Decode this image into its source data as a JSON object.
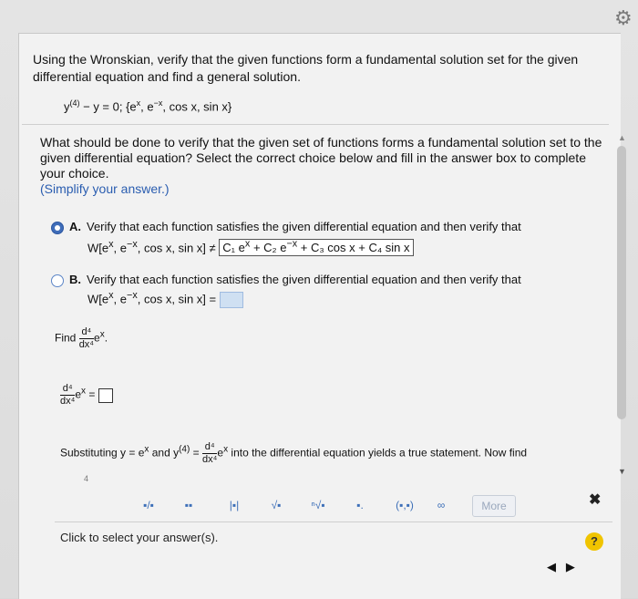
{
  "question_intro": "Using the Wronskian, verify that the given functions form a fundamental solution set for the given differential equation and find a general solution.",
  "equation": {
    "lhs": "y",
    "order_sup": "(4)",
    "rest": " − y = 0;  {e",
    "e_sup1": "x",
    "mid1": ", e",
    "e_sup2": "−x",
    "tail": ", cos x, sin x}"
  },
  "prompt": "What should be done to verify that the given set of functions forms a fundamental solution set to the given differential equation? Select the correct choice below and fill in the answer box to complete your choice.",
  "hint": "(Simplify your answer.)",
  "choices": {
    "A": {
      "label": "A.",
      "text": "Verify that each function satisfies the given differential equation and then verify that",
      "w_prefix": "W[e",
      "w_sup1": "x",
      "w_mid": ", e",
      "w_sup2": "−x",
      "w_tail": ", cos x, sin x]",
      "relation": "≠",
      "answer": "C₁ e",
      "ans_sup1": "x",
      "answer2": " + C₂ e",
      "ans_sup2": "−x",
      "answer3": " + C₃ cos x + C₄ sin x",
      "selected": true
    },
    "B": {
      "label": "B.",
      "text": "Verify that each function satisfies the given differential equation and then verify that",
      "w_prefix": "W[e",
      "w_sup1": "x",
      "w_mid": ", e",
      "w_sup2": "−x",
      "w_tail": ", cos x, sin x]",
      "relation": "=",
      "selected": false
    }
  },
  "find": {
    "label": "Find",
    "num": "d⁴",
    "den": "dx⁴",
    "expr": "e",
    "expr_sup": "x",
    "period": "."
  },
  "derivative_eq": {
    "num": "d⁴",
    "den": "dx⁴",
    "expr": "e",
    "expr_sup": "x",
    "equals": "="
  },
  "substitution": {
    "text1": "Substituting y = e",
    "sup1": "x",
    "text2": " and y",
    "sup2": "(4)",
    "text3": " = ",
    "num": "d⁴",
    "den": "dx⁴",
    "text4": "e",
    "sup3": "x",
    "text5": " into the differential equation yields a true statement. Now find"
  },
  "toolbar": {
    "items": [
      "▪/▪",
      "▪▪",
      "|▪|",
      "√▪",
      "ⁿ√▪",
      "▪.",
      "(▪,▪)",
      "∞",
      "More"
    ]
  },
  "close_label": "✖",
  "status_text": "Click to select your answer(s).",
  "help_label": "?",
  "nav": {
    "prev": "◀",
    "next": "▶"
  },
  "gear": "⚙",
  "dots": "4"
}
